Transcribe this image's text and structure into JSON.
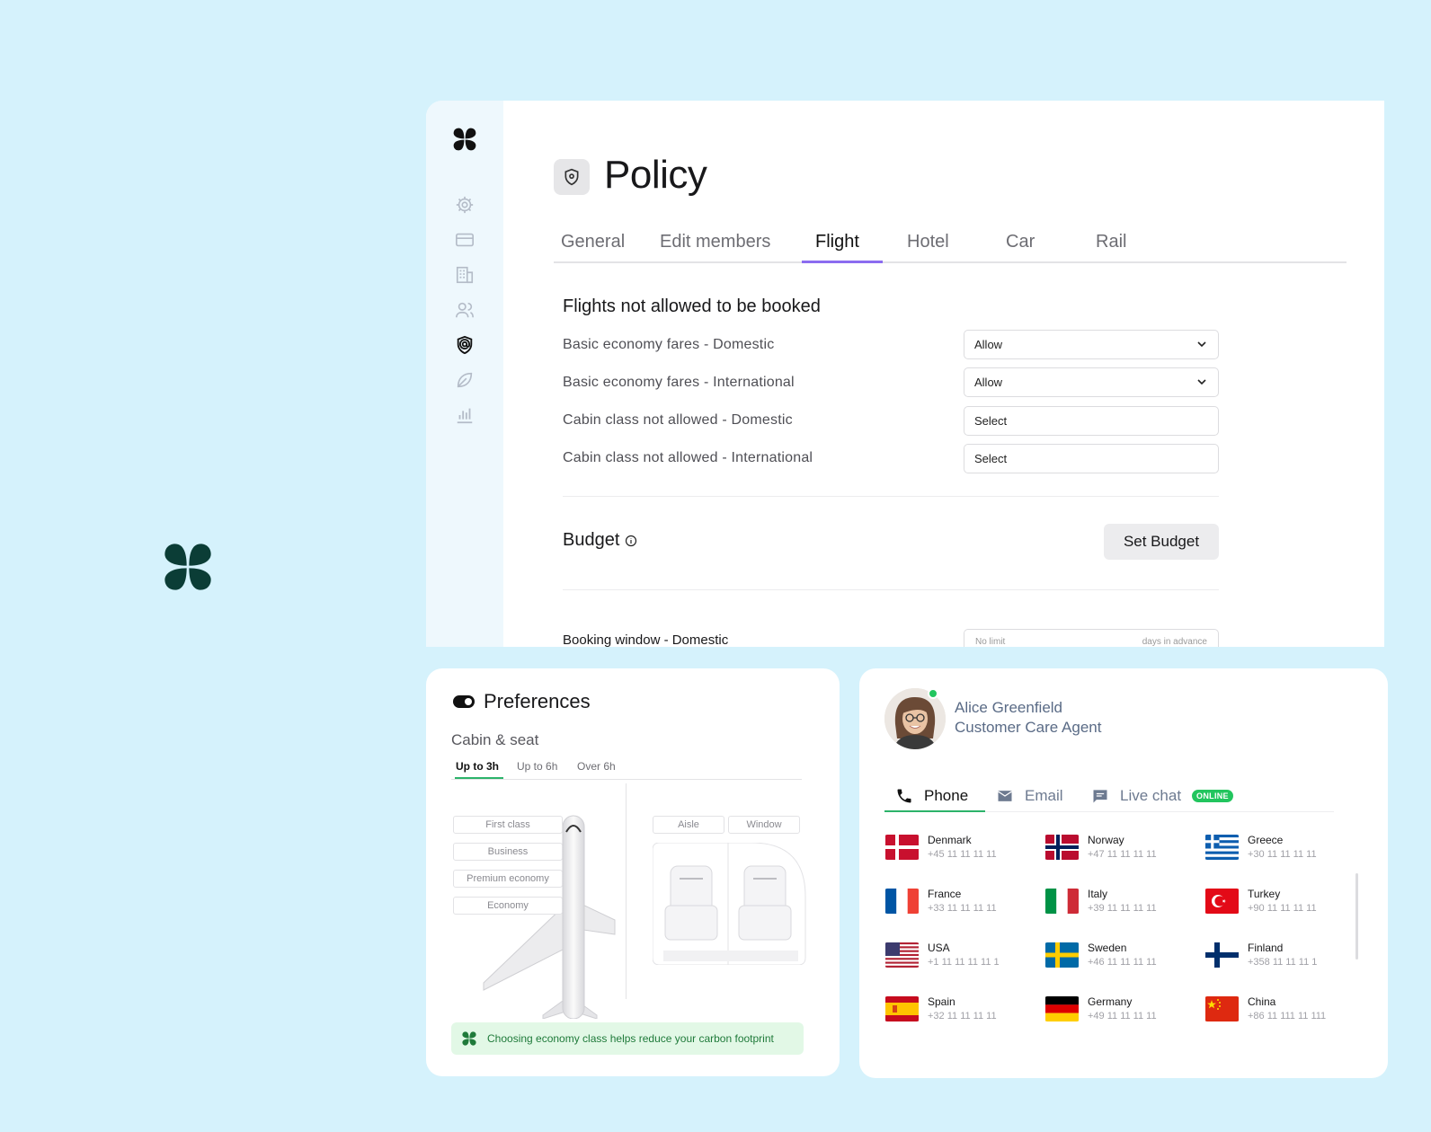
{
  "policy": {
    "title": "Policy",
    "tabs": [
      "General",
      "Edit members",
      "Flight",
      "Hotel",
      "Car",
      "Rail"
    ],
    "active_tab": "Flight",
    "section_title": "Flights not allowed to be booked",
    "rows": [
      {
        "label": "Basic economy fares - Domestic",
        "value": "Allow",
        "dropdown": true
      },
      {
        "label": "Basic economy fares - International",
        "value": "Allow",
        "dropdown": true
      },
      {
        "label": "Cabin class not allowed - Domestic",
        "value": "Select",
        "dropdown": false
      },
      {
        "label": "Cabin class not allowed - International",
        "value": "Select",
        "dropdown": false
      }
    ],
    "budget_label": "Budget",
    "set_budget": "Set Budget",
    "booking_label": "Booking window - Domestic",
    "booking_placeholder": "No limit",
    "booking_suffix": "days in advance"
  },
  "sidebar": [
    "logo",
    "gear-icon",
    "card-icon",
    "building-icon",
    "users-icon",
    "policy-icon",
    "leaf-icon",
    "chart-icon"
  ],
  "preferences": {
    "title": "Preferences",
    "subtitle": "Cabin & seat",
    "tabs": [
      "Up to 3h",
      "Up to 6h",
      "Over 6h"
    ],
    "classes": [
      "First class",
      "Business",
      "Premium economy",
      "Economy"
    ],
    "seats": [
      "Aisle",
      "Window"
    ],
    "note": "Choosing economy class helps reduce your carbon footprint"
  },
  "agent": {
    "name": "Alice Greenfield",
    "role": "Customer Care Agent",
    "tabs": [
      "Phone",
      "Email",
      "Live chat"
    ],
    "badge": "ONLINE",
    "countries": [
      {
        "name": "Denmark",
        "phone": "+45 11 11 11 11"
      },
      {
        "name": "Norway",
        "phone": "+47 11 11 11 11"
      },
      {
        "name": "Greece",
        "phone": "+30 11 11 11 11"
      },
      {
        "name": "France",
        "phone": "+33 11 11 11 11"
      },
      {
        "name": "Italy",
        "phone": "+39 11 11 11 11"
      },
      {
        "name": "Turkey",
        "phone": "+90 11 11 11 11"
      },
      {
        "name": "USA",
        "phone": "+1 11 11 11 11 1"
      },
      {
        "name": "Sweden",
        "phone": "+46 11 11 11 11"
      },
      {
        "name": "Finland",
        "phone": "+358 11 11 11 1"
      },
      {
        "name": "Spain",
        "phone": "+32 11 11 11 11"
      },
      {
        "name": "Germany",
        "phone": "+49 11 11 11 11"
      },
      {
        "name": "China",
        "phone": "+86 11 111 11 111"
      }
    ]
  },
  "colors": {
    "background": "#d5f2fc",
    "brand": "#0b3d36",
    "accent": "#8b6cf0",
    "green": "#22c55e"
  }
}
